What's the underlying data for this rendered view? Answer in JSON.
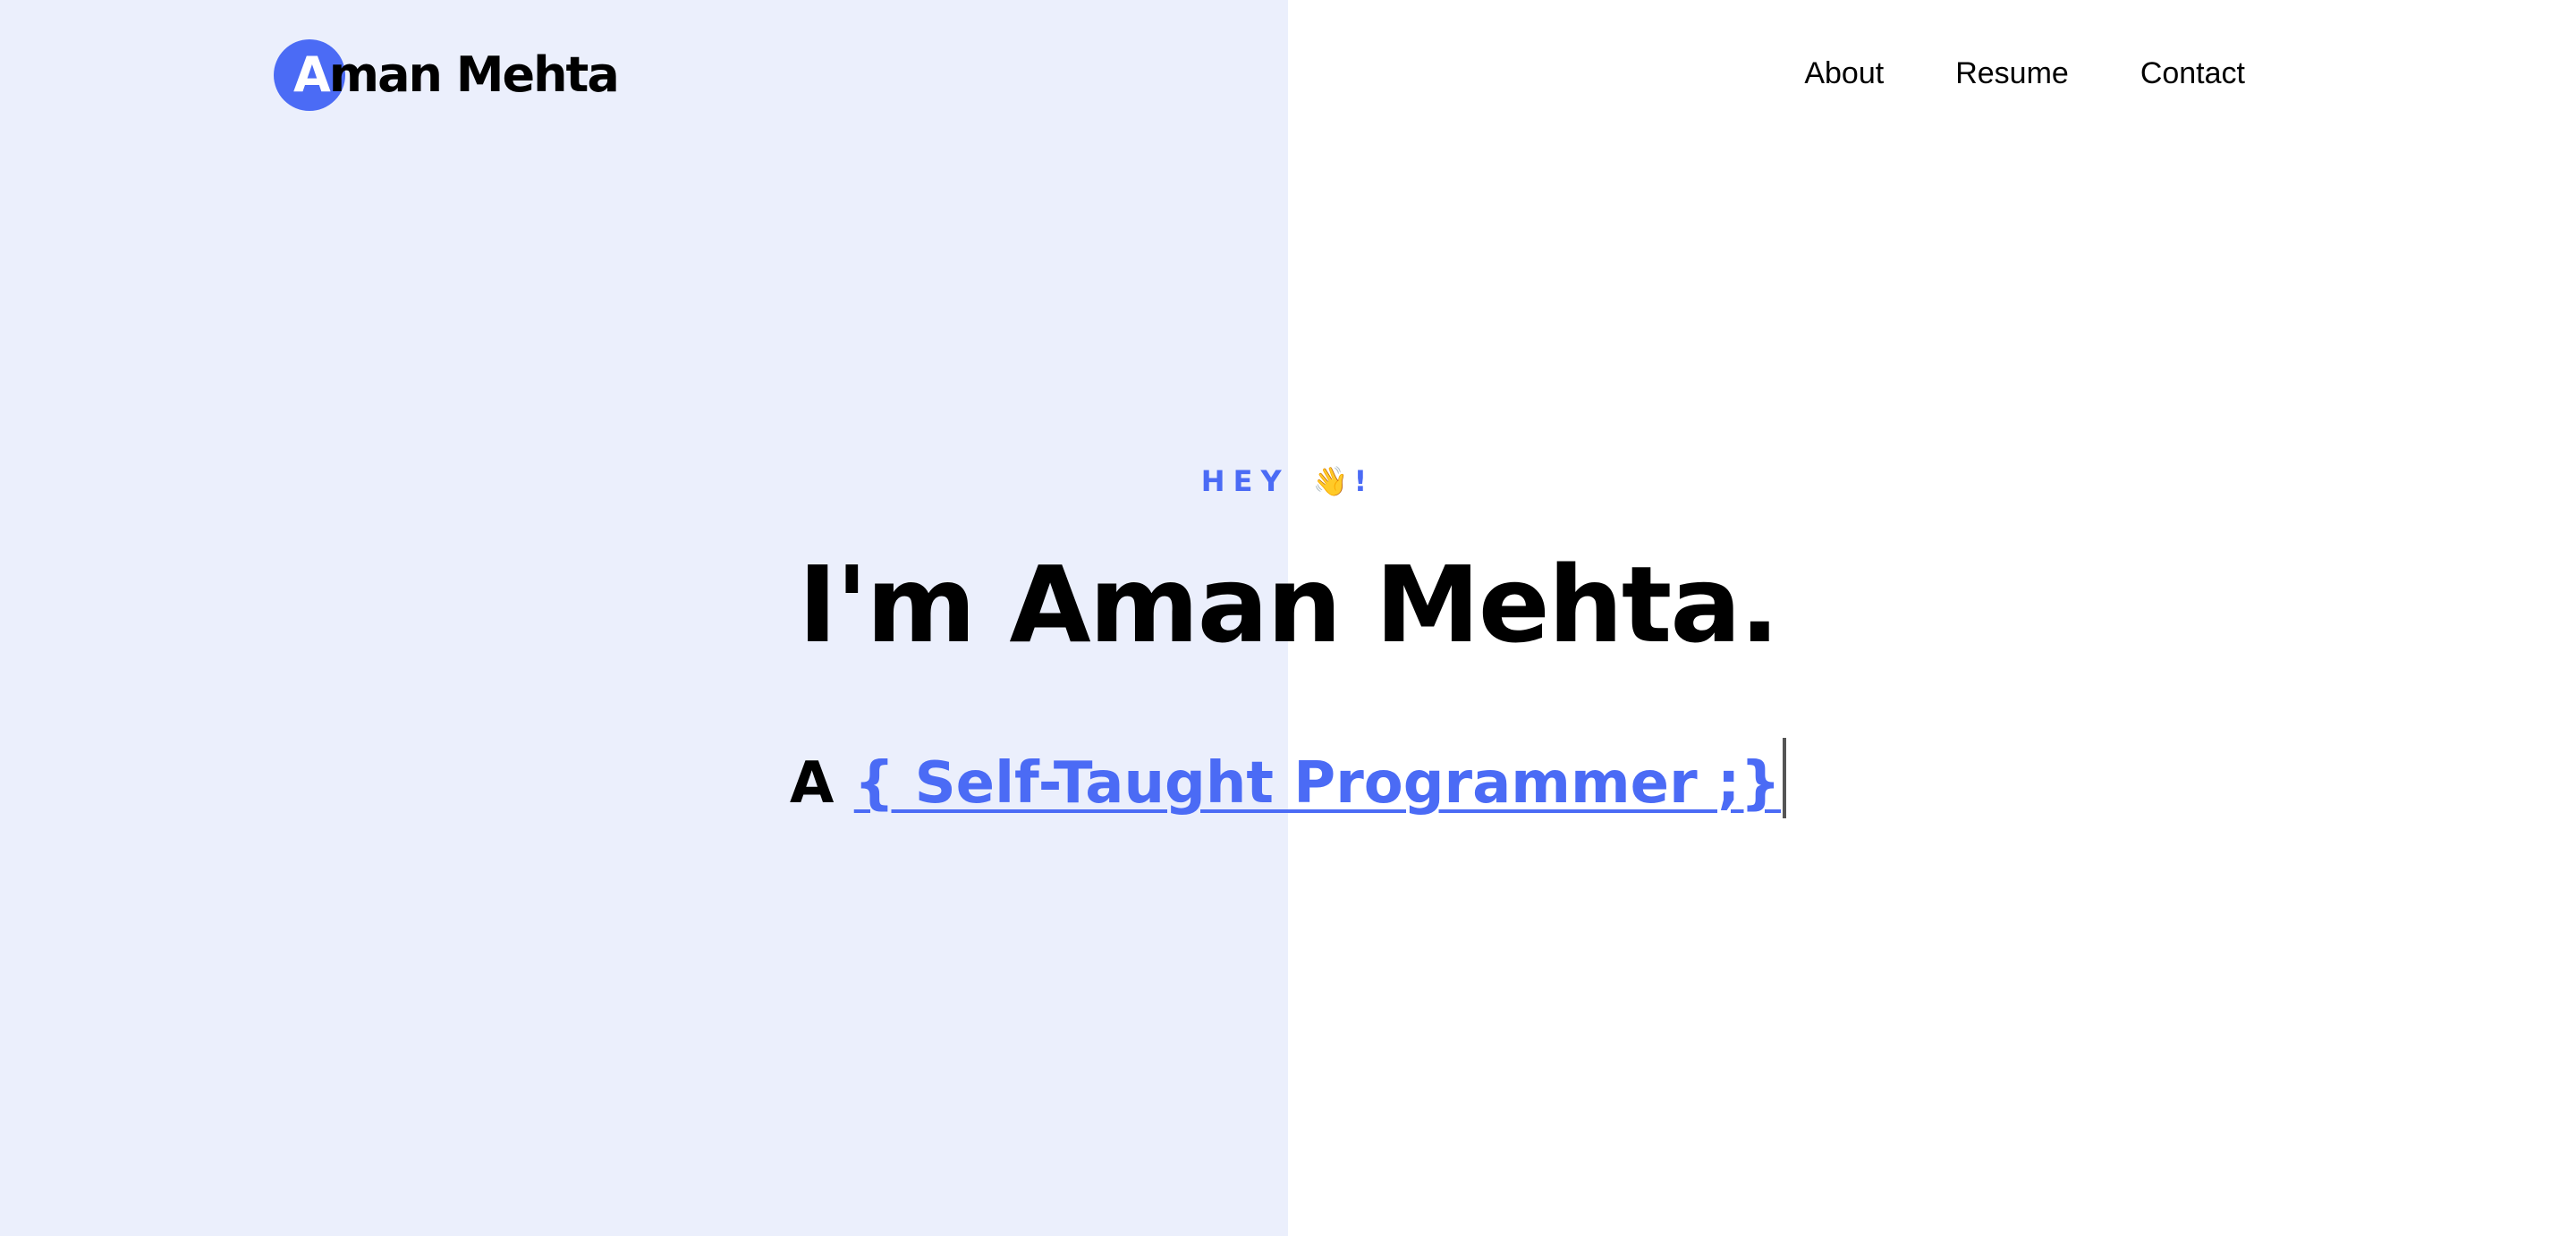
{
  "logo": {
    "initial": "A",
    "rest": "man Mehta"
  },
  "nav": {
    "items": [
      {
        "label": "About"
      },
      {
        "label": "Resume"
      },
      {
        "label": "Contact"
      }
    ]
  },
  "hero": {
    "greeting": "HEY",
    "greeting_emoji": "👋",
    "greeting_suffix": "!",
    "title": "I'm Aman Mehta.",
    "subtitle_prefix": "A",
    "subtitle_typed": "{ Self-Taught Programmer ;}"
  },
  "colors": {
    "accent": "#4b6bf5",
    "left_panel": "#ebeffc",
    "background": "#ffffff",
    "text": "#000000"
  }
}
